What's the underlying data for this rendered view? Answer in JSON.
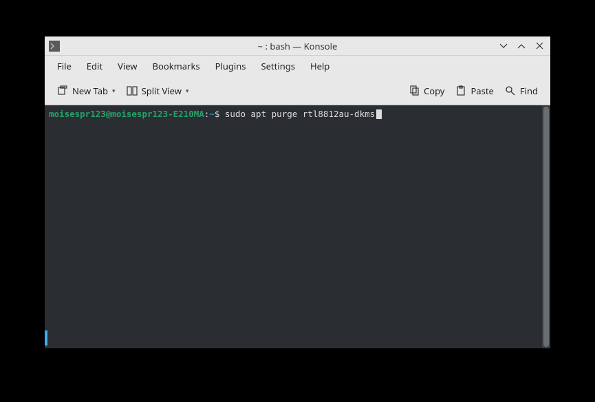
{
  "window": {
    "title": "~ : bash — Konsole",
    "app_icon": "terminal-icon"
  },
  "menu": {
    "items": [
      "File",
      "Edit",
      "View",
      "Bookmarks",
      "Plugins",
      "Settings",
      "Help"
    ]
  },
  "toolbar": {
    "new_tab": "New Tab",
    "split_view": "Split View",
    "copy": "Copy",
    "paste": "Paste",
    "find": "Find"
  },
  "terminal": {
    "prompt_user_host": "moisespr123@moisespr123-E210MA",
    "prompt_separator": ":",
    "prompt_path": "~",
    "prompt_symbol": "$",
    "command": "sudo apt purge rtl8812au-dkms"
  }
}
